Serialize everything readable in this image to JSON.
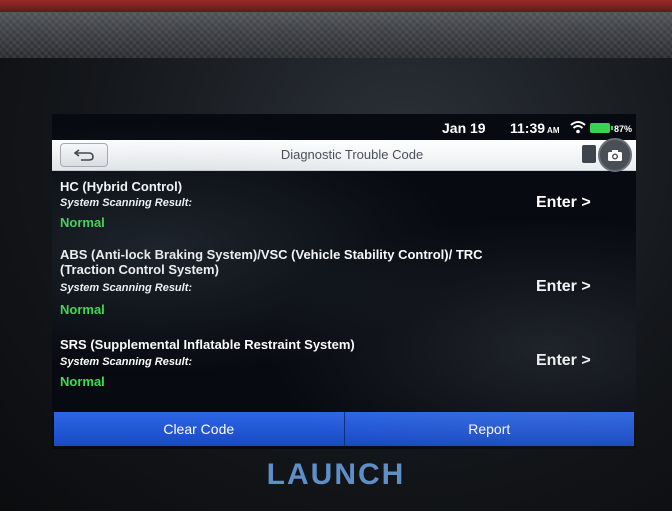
{
  "status": {
    "date": "Jan 19",
    "time": "11:39",
    "ampm": "AM",
    "battery": "87%"
  },
  "header": {
    "title": "Diagnostic Trouble Code"
  },
  "systems": [
    {
      "name": "HC (Hybrid Control)",
      "sub": "System Scanning Result:",
      "status": "Normal",
      "enter": "Enter >"
    },
    {
      "name": "ABS (Anti-lock Braking System)/VSC (Vehicle Stability Control)/ TRC (Traction Control System)",
      "sub": "System Scanning Result:",
      "status": "Normal",
      "enter": "Enter >"
    },
    {
      "name": "SRS (Supplemental Inflatable Restraint System)",
      "sub": "System Scanning Result:",
      "status": "Normal",
      "enter": "Enter >"
    }
  ],
  "actions": {
    "clear": "Clear Code",
    "report": "Report"
  },
  "brand": "LAUNCH",
  "colors": {
    "status_normal": "#3ddc4f",
    "button_blue": "#2c66e6",
    "battery": "#39d353"
  },
  "icons": {
    "back": "back-arrow-icon",
    "camera": "camera-icon",
    "wifi": "wifi-icon",
    "battery": "battery-icon"
  }
}
